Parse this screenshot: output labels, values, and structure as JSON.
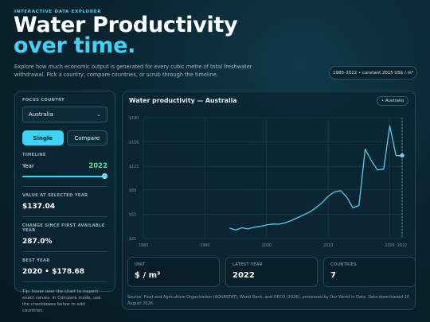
{
  "header": {
    "eyebrow": "INTERACTIVE DATA EXPLORER",
    "title_line1": "Water Productivity",
    "title_line2": "over time.",
    "intro": "Explore how much economic output is generated for every cubic metre of total freshwater withdrawal. Pick a country, compare countries, or scrub through the timeline.",
    "range_pill": "1980–2022 • constant 2015 US$ / m³"
  },
  "sidebar": {
    "focus_label": "FOCUS COUNTRY",
    "country": "Australia",
    "mode_single": "Single",
    "mode_compare": "Compare",
    "timeline_label": "TIMELINE",
    "year_label": "Year",
    "year_value": "2022",
    "slider_fraction": 1.0,
    "value_label": "VALUE AT SELECTED YEAR",
    "value": "$137.04",
    "change_label": "CHANGE SINCE FIRST AVAILABLE YEAR",
    "change": "287.0%",
    "best_label": "BEST YEAR",
    "best": "2020 • $178.68",
    "tip": "Tip: hover over the chart to inspect exact values. In Compare mode, use the checkboxes below to add countries."
  },
  "main": {
    "chart_title": "Water productivity — Australia",
    "legend_label": "Australia",
    "cards": [
      {
        "label": "UNIT",
        "value": "$ / m³"
      },
      {
        "label": "LATEST YEAR",
        "value": "2022"
      },
      {
        "label": "COUNTRIES",
        "value": "7"
      }
    ],
    "source": "Source: Food and Agriculture Organization (AQUASTAT), World Bank, and OECD (2026), processed by Our World in Data. Data downloaded 20 August 2026."
  },
  "colors": {
    "accent": "#3fd3f5",
    "positive": "#4ee69b",
    "line": "#54cdf2"
  },
  "chart_data": {
    "type": "line",
    "title": "Water productivity — Australia",
    "xlim": [
      1980,
      2022
    ],
    "ylim": [
      21,
      190
    ],
    "x_ticks": [
      "1980",
      "1990",
      "2000",
      "2010",
      "2020",
      "2022"
    ],
    "x_tick_values": [
      1980,
      1990,
      2000,
      2010,
      2020,
      2022
    ],
    "y_ticks": [
      "$190",
      "$156",
      "$122",
      "$89",
      "$55",
      "$21"
    ],
    "y_tick_values": [
      190,
      156,
      122,
      89,
      55,
      21
    ],
    "grid": true,
    "series": [
      {
        "name": "Australia",
        "x": [
          1994,
          1995,
          1996,
          1997,
          1998,
          1999,
          2000,
          2001,
          2002,
          2003,
          2004,
          2005,
          2006,
          2007,
          2008,
          2009,
          2010,
          2011,
          2012,
          2013,
          2014,
          2015,
          2016,
          2017,
          2018,
          2019,
          2020,
          2021,
          2022
        ],
        "y": [
          35.4,
          33,
          36,
          34.5,
          36.8,
          38,
          40,
          41.2,
          41,
          43,
          46,
          50,
          54,
          58,
          64,
          71,
          80,
          86,
          88,
          79,
          64,
          67,
          146,
          130,
          117,
          118,
          178.68,
          137,
          137.04
        ]
      }
    ],
    "selected": {
      "x": 2022,
      "y": 137.04
    }
  }
}
